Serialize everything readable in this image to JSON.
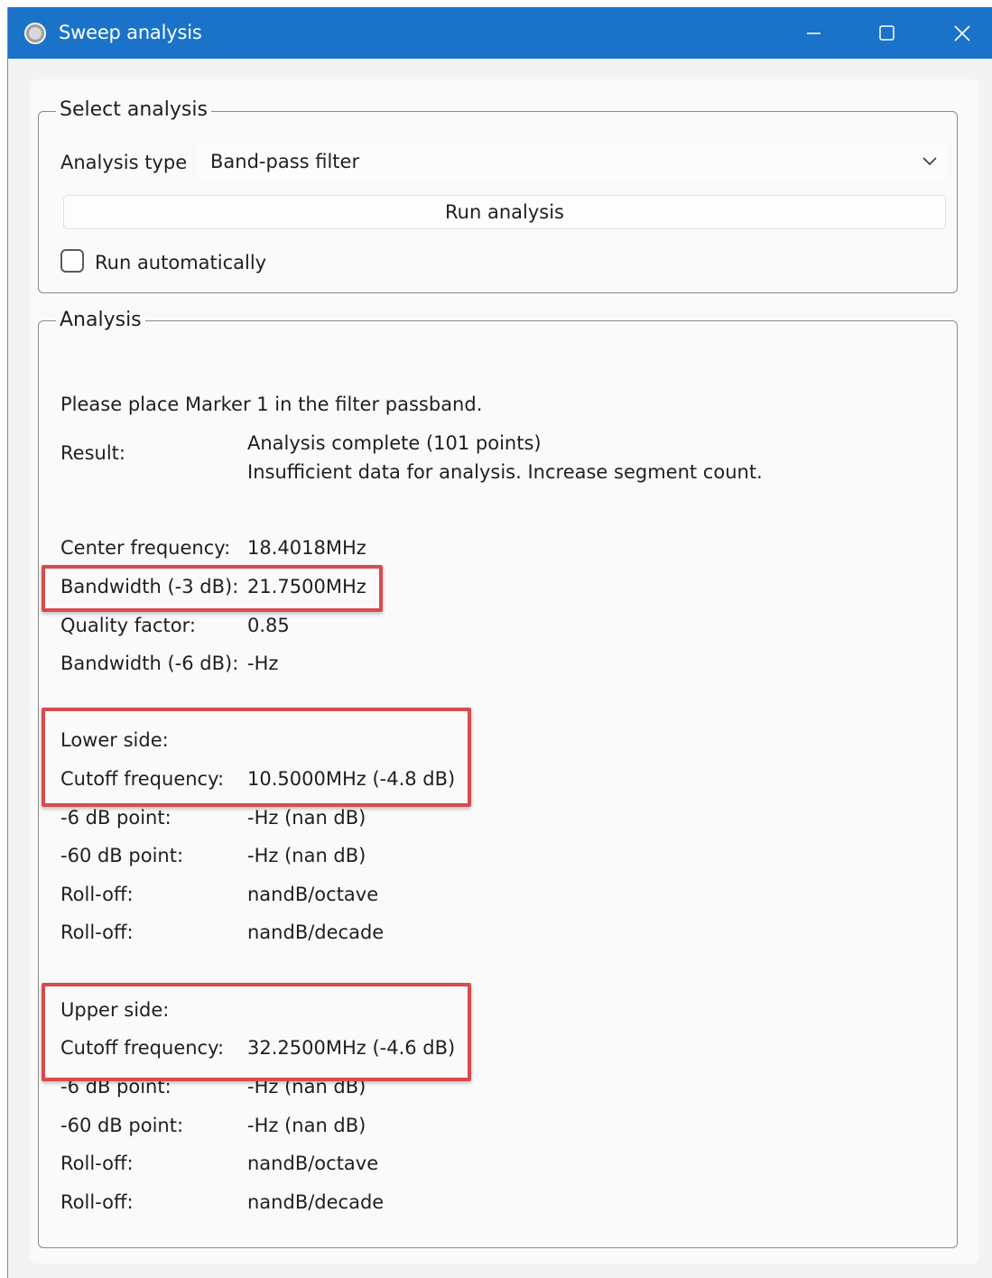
{
  "window": {
    "title": "Sweep analysis",
    "title_bar_color": "#1a73c8",
    "highlight_color": "#d94b4e"
  },
  "select_group": {
    "legend": "Select analysis",
    "analysis_type_label": "Analysis type",
    "analysis_type_value": "Band-pass filter",
    "run_button_label": "Run analysis",
    "run_automatically_label": "Run automatically",
    "run_automatically_checked": false
  },
  "analysis_group": {
    "legend": "Analysis",
    "instruction": "Please place Marker 1 in the filter passband.",
    "result_label": "Result:",
    "result_lines": [
      "Analysis complete (101 points)",
      "Insufficient data for analysis. Increase segment count."
    ],
    "summary": [
      {
        "label": "Center frequency:",
        "value": "18.4018MHz"
      },
      {
        "label": "Bandwidth (-3 dB):",
        "value": "21.7500MHz"
      },
      {
        "label": "Quality factor:",
        "value": "0.85"
      },
      {
        "label": "Bandwidth (-6 dB):",
        "value": "-Hz"
      }
    ],
    "lower_side": {
      "heading": "Lower side:",
      "rows": [
        {
          "label": "Cutoff frequency:",
          "value": "10.5000MHz (-4.8 dB)"
        },
        {
          "label": "-6 dB point:",
          "value": "-Hz (nan dB)"
        },
        {
          "label": "-60 dB point:",
          "value": "-Hz (nan dB)"
        },
        {
          "label": "Roll-off:",
          "value": "nandB/octave"
        },
        {
          "label": "Roll-off:",
          "value": "nandB/decade"
        }
      ]
    },
    "upper_side": {
      "heading": "Upper side:",
      "rows": [
        {
          "label": "Cutoff frequency:",
          "value": "32.2500MHz (-4.6 dB)"
        },
        {
          "label": "-6 dB point:",
          "value": "-Hz (nan dB)"
        },
        {
          "label": "-60 dB point:",
          "value": "-Hz (nan dB)"
        },
        {
          "label": "Roll-off:",
          "value": "nandB/octave"
        },
        {
          "label": "Roll-off:",
          "value": "nandB/decade"
        }
      ]
    }
  }
}
